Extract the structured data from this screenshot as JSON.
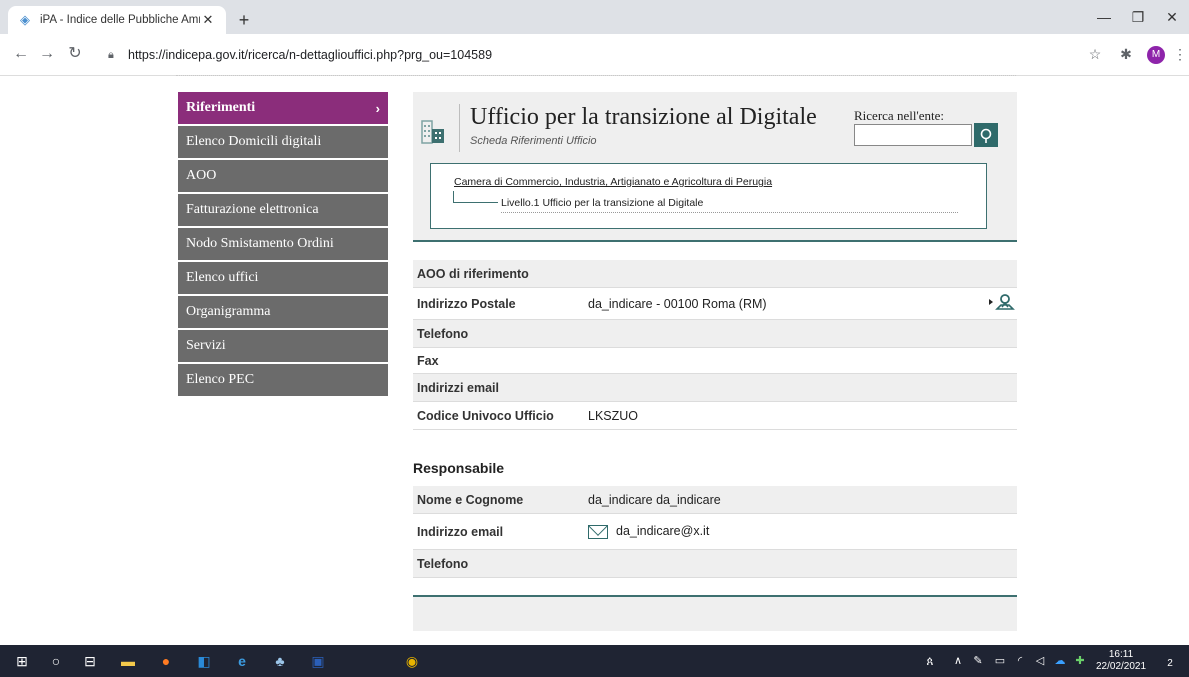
{
  "browser": {
    "tab_title": "iPA - Indice delle Pubbliche Amm",
    "url": "https://indicepa.gov.it/ricerca/n-dettagliouffici.php?prg_ou=104589",
    "avatar_letter": "M"
  },
  "sidebar": {
    "items": [
      {
        "label": "Riferimenti",
        "active": true
      },
      {
        "label": "Elenco Domicili digitali"
      },
      {
        "label": "AOO"
      },
      {
        "label": "Fatturazione elettronica"
      },
      {
        "label": "Nodo Smistamento Ordini"
      },
      {
        "label": "Elenco uffici"
      },
      {
        "label": "Organigramma"
      },
      {
        "label": "Servizi"
      },
      {
        "label": "Elenco PEC"
      }
    ]
  },
  "header": {
    "title": "Ufficio per la transizione al Digitale",
    "subtitle": "Scheda Riferimenti Ufficio",
    "search_label": "Ricerca nell'ente:"
  },
  "breadcrumb": {
    "entity": "Camera di Commercio, Industria, Artigianato e Agricoltura di Perugia",
    "level": "Livello.1 Ufficio per la transizione al Digitale"
  },
  "details": [
    {
      "label": "AOO di riferimento",
      "value": ""
    },
    {
      "label": "Indirizzo Postale",
      "value": "da_indicare - 00100 Roma (RM)"
    },
    {
      "label": "Telefono",
      "value": ""
    },
    {
      "label": "Fax",
      "value": ""
    },
    {
      "label": "Indirizzi email",
      "value": ""
    },
    {
      "label": "Codice Univoco Ufficio",
      "value": "LKSZUO"
    }
  ],
  "responsabile": {
    "title": "Responsabile",
    "rows": [
      {
        "label": "Nome e Cognome",
        "value": "da_indicare da_indicare"
      },
      {
        "label": "Indirizzo email",
        "value": "da_indicare@x.it"
      },
      {
        "label": "Telefono",
        "value": ""
      }
    ]
  },
  "taskbar": {
    "time": "16:11",
    "date": "22/02/2021",
    "notification_count": "2"
  },
  "colors": {
    "menu_active": "#8b2d7b",
    "menu_bg": "#6b6b6b",
    "accent": "#2f6a6a"
  }
}
